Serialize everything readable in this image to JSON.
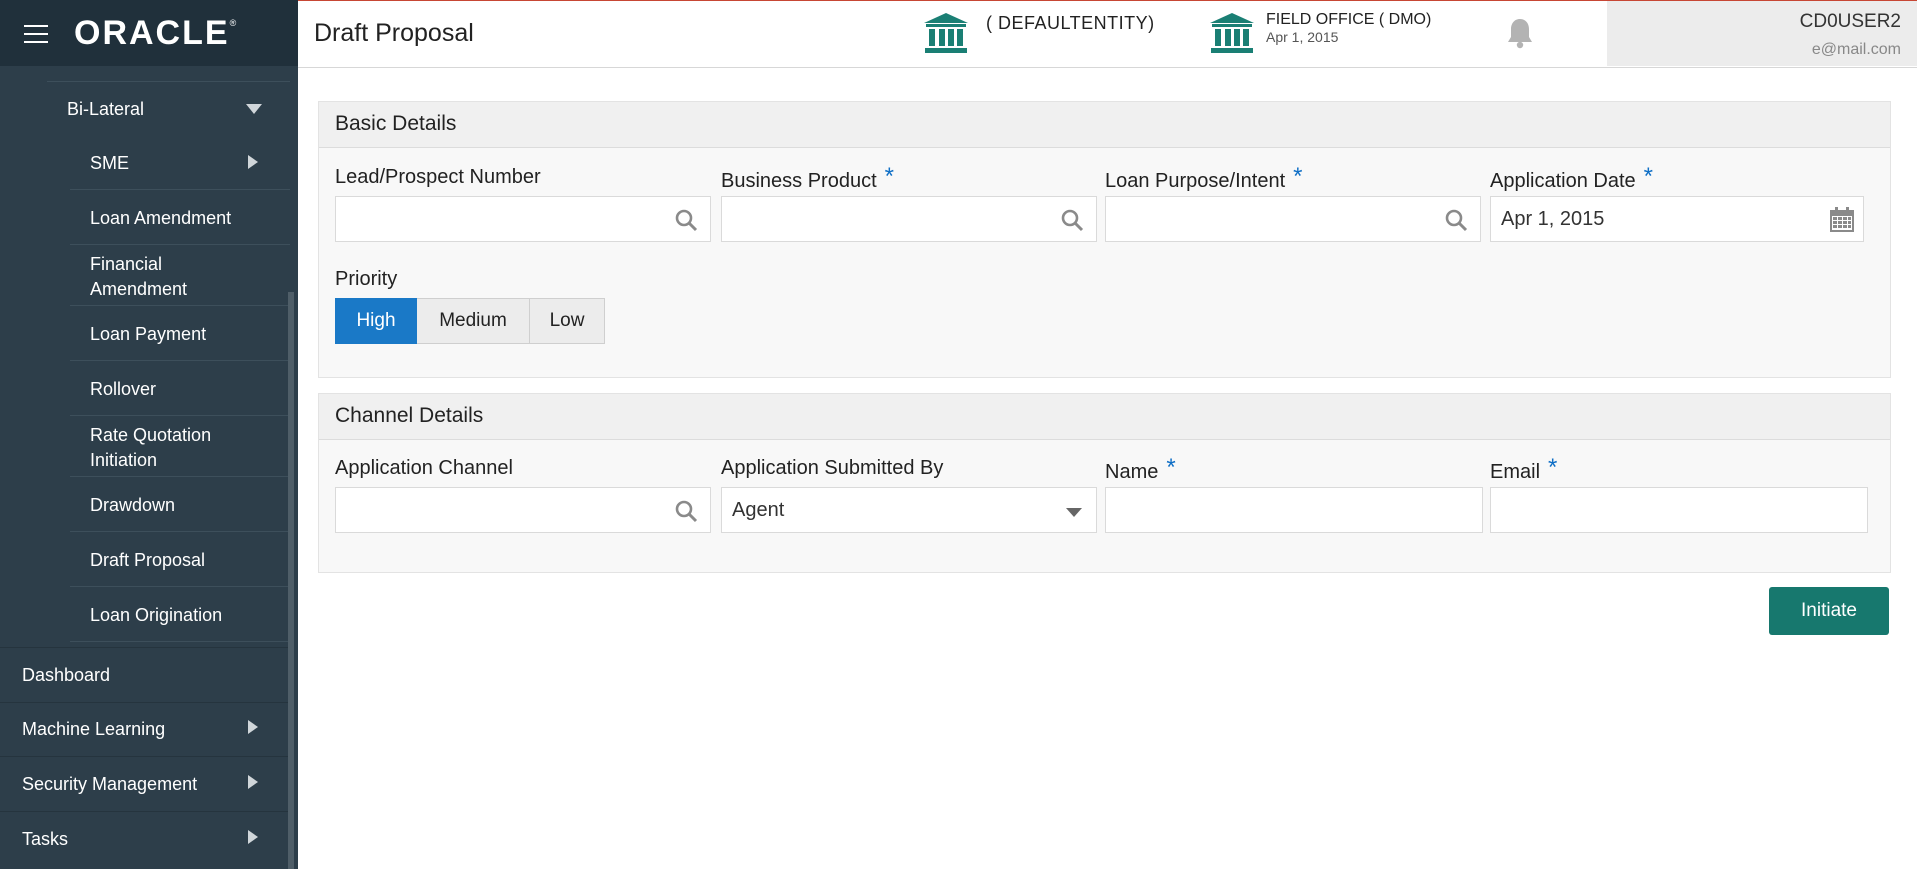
{
  "brand": {
    "logo_text": "ORACLE",
    "logo_mark": "®"
  },
  "sidebar": {
    "group_label": "Bi-Lateral",
    "sub_items": [
      {
        "label": "SME",
        "has_submenu": true
      },
      {
        "label": "Loan Amendment"
      },
      {
        "label": "Financial Amendment"
      },
      {
        "label": "Loan Payment"
      },
      {
        "label": "Rollover"
      },
      {
        "label": "Rate Quotation Initiation"
      },
      {
        "label": "Drawdown"
      },
      {
        "label": "Draft Proposal"
      },
      {
        "label": "Loan Origination"
      }
    ],
    "top_items": [
      {
        "label": "Dashboard"
      },
      {
        "label": "Machine Learning",
        "has_submenu": true
      },
      {
        "label": "Security Management",
        "has_submenu": true
      },
      {
        "label": "Tasks",
        "has_submenu": true
      }
    ]
  },
  "header": {
    "title": "Draft Proposal",
    "entity": "( DEFAULTENTITY)",
    "office_name": "FIELD OFFICE  ( DMO)",
    "office_date": "Apr 1, 2015",
    "user_name": "CD0USER2",
    "user_email": "e@mail.com",
    "icons": {
      "entity": "bank-icon",
      "office": "bank-icon",
      "notifications": "bell-icon"
    },
    "accent_color": "#1a7f74"
  },
  "basic_details": {
    "title": "Basic Details",
    "fields": [
      {
        "label": "Lead/Prospect Number",
        "required": false,
        "value": "",
        "icon": "search-icon"
      },
      {
        "label": "Business Product",
        "required": true,
        "value": "",
        "icon": "search-icon"
      },
      {
        "label": "Loan Purpose/Intent",
        "required": true,
        "value": "",
        "icon": "search-icon"
      },
      {
        "label": "Application Date",
        "required": true,
        "value": "Apr 1, 2015",
        "icon": "calendar-icon"
      }
    ],
    "priority": {
      "label": "Priority",
      "options": [
        "High",
        "Medium",
        "Low"
      ],
      "selected": "High",
      "selected_color": "#1a79c7"
    }
  },
  "channel_details": {
    "title": "Channel Details",
    "fields": [
      {
        "label": "Application Channel",
        "required": false,
        "value": "",
        "icon": "search-icon"
      },
      {
        "label": "Application Submitted By",
        "required": false,
        "value": "Agent",
        "icon": "chevron-down-icon"
      },
      {
        "label": "Name",
        "required": true,
        "value": ""
      },
      {
        "label": "Email",
        "required": true,
        "value": ""
      }
    ]
  },
  "actions": {
    "initiate_label": "Initiate",
    "initiate_color": "#17786e"
  },
  "required_marker": "*"
}
